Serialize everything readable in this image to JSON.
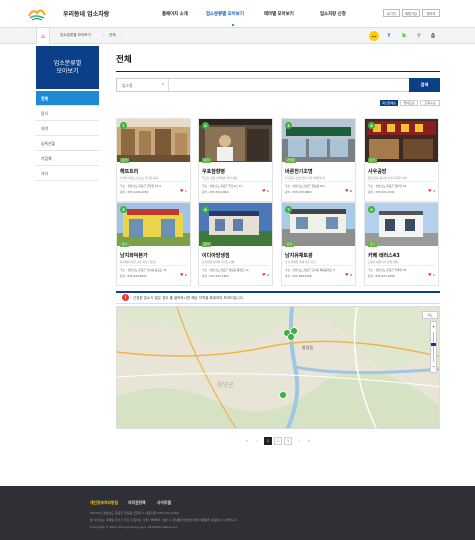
{
  "header": {
    "logo_text": "우리동네\n창녕",
    "site_title": "우리동네 업소자랑",
    "nav": [
      "홈페이지 소개",
      "업소분류별 모아보기",
      "테마별 모아보기",
      "업소자랑 신청"
    ],
    "top_buttons": [
      "로그인",
      "회원가입",
      "관리자"
    ]
  },
  "breadcrumb": {
    "home_icon": "home-icon",
    "level1": "업소분류별 모아보기",
    "level2": "전체"
  },
  "share_icons": [
    "kakaostory-icon",
    "facebook-icon",
    "blog-icon",
    "link-icon",
    "print-icon"
  ],
  "sidebar": {
    "title": "업소분류별\n모아보기",
    "items": [
      "전체",
      "음식",
      "숙박",
      "농특산물",
      "기업체",
      "기타"
    ]
  },
  "main": {
    "title": "전체",
    "search": {
      "select_label": "업소명",
      "placeholder": "",
      "button": "검색"
    },
    "sort_buttons": [
      "최신업체순",
      "좋아요순",
      "조회수순"
    ]
  },
  "cards": [
    {
      "num": "1",
      "tag": "음식",
      "name": "해뜨트리",
      "desc": "신선한 재료로 만드는 건강한 음식",
      "addr": "주소 : 경상남도 창녕군 군청길 23-9",
      "tel": "문의 : 055-1234-0052",
      "likes": "1"
    },
    {
      "num": "2",
      "tag": "음식",
      "name": "우포참향병",
      "desc": "우포늪 청정 자연에서 자란 재료",
      "addr": "주소 : 경상남도 창녕군 우포2로 11",
      "tel": "문의 : 055-532-0452",
      "likes": "6"
    },
    {
      "num": "3",
      "tag": "기업체",
      "name": "바른전기조명",
      "desc": "전기공사 조명 설치 전문 업체입니다",
      "addr": "주소 : 경상남도 창녕군 창녕읍 101",
      "tel": "문의 : 055-533-6863",
      "likes": "8"
    },
    {
      "num": "4",
      "tag": "음식",
      "name": "사우공방",
      "desc": "창녕 전통 음식과 정성 가득한 식당",
      "addr": "주소 : 경상남도 창녕군 영산면 22",
      "tel": "문의 : 055-521-1541",
      "likes": "3"
    },
    {
      "num": "5",
      "tag": "음식",
      "name": "남지화덕본가",
      "desc": "화덕에서 직접 구운 피자 전문점",
      "addr": "주소 : 경상남도 창녕군 남지읍 동포로 31",
      "tel": "문의 : 055-526-8592",
      "likes": "9"
    },
    {
      "num": "6",
      "tag": "음식",
      "name": "이디아방생점",
      "desc": "프리미엄 커피와 디저트 카페",
      "addr": "주소 : 경상남도 창녕군 창녕읍 중앙로 14",
      "tel": "문의 : 055-532-3365",
      "likes": "2"
    },
    {
      "num": "7",
      "tag": "음식",
      "name": "남지유채토광",
      "desc": "남지 유채꽃 축제 인근 맛집",
      "addr": "주소 : 경상남도 창녕군 남지읍 체육공원로 5",
      "tel": "문의 : 055-368-5338",
      "likes": "8"
    },
    {
      "num": "8",
      "tag": "음식",
      "name": "카페 태리스43",
      "desc": "조용한 분위기의 감성 카페",
      "addr": "주소 : 경상남도 창녕군 부곡면 43",
      "tel": "문의 : 055-521-4358",
      "likes": "1"
    }
  ],
  "notice": {
    "icon": "!",
    "text": "근접한 업소가 많은 경우 를 클릭하시면 해당 지역을 확대하여 보여드립니다."
  },
  "map": {
    "control_top": "지도",
    "label1": "창녕읍",
    "label2": "창녕군"
  },
  "pagination": {
    "prev_all": "«",
    "prev": "‹",
    "pages": [
      "1",
      "2",
      "3"
    ],
    "current": "1",
    "next": "›",
    "next_all": "»"
  },
  "footer": {
    "links": [
      "개인정보처리방침",
      "저작권정책",
      "사이트맵"
    ],
    "line1": "(50325) 경상남도 창녕군 창녕읍 군청길 1   대표전화 055-530-1000",
    "line2": "본 사이트는 이메일 주소가 무단 수집되는 것을 거부하며, 위반 시 정보통신망법에 의해 처벌됨을 유념하시기 바랍니다.",
    "copyright": "Copyright © 2021 Changnyeong-gun. All Rights Reserved."
  },
  "colors": {
    "primary": "#0b3f87",
    "accent": "#1e8ad6",
    "green": "#3db33d",
    "footer": "#2f3035"
  }
}
